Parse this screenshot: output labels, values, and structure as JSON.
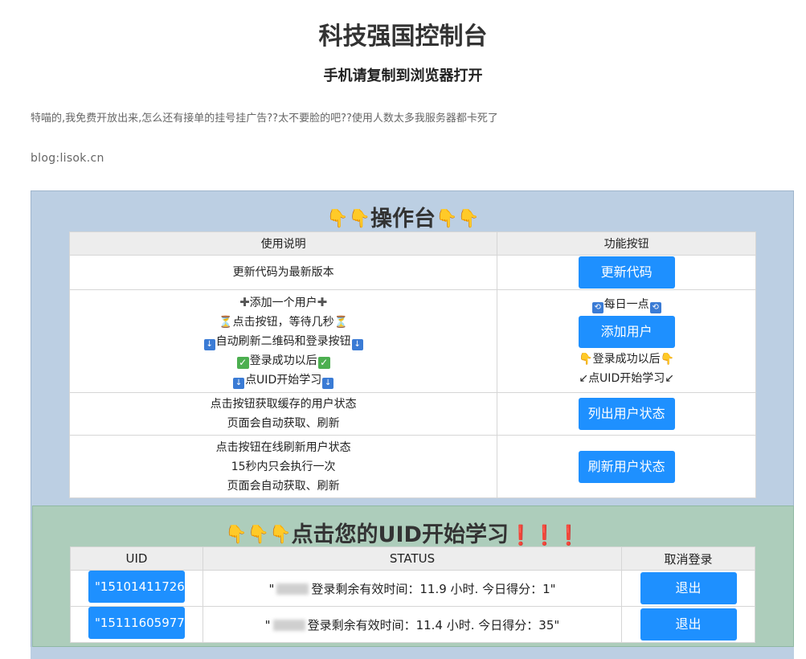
{
  "header": {
    "title": "科技强国控制台",
    "subtitle": "手机请复制到浏览器打开",
    "notice": "特喵的,我免费开放出来,怎么还有接单的挂号挂广告??太不要脸的吧??使用人数太多我服务器都卡死了",
    "blog": "blog:lisok.cn"
  },
  "ops_panel": {
    "title": "操作台",
    "columns": [
      "使用说明",
      "功能按钮"
    ],
    "rows": [
      {
        "desc": [
          "更新代码为最新版本"
        ],
        "button": "更新代码"
      },
      {
        "desc": [
          "添加一个用户",
          "点击按钮，等待几秒",
          "自动刷新二维码和登录按钮",
          "登录成功以后",
          "点UID开始学习"
        ],
        "above": "每日一点",
        "button": "添加用户",
        "below": [
          "登录成功以后",
          "点UID开始学习"
        ]
      },
      {
        "desc": [
          "点击按钮获取缓存的用户状态",
          "页面会自动获取、刷新"
        ],
        "button": "列出用户状态"
      },
      {
        "desc": [
          "点击按钮在线刷新用户状态",
          "15秒内只会执行一次",
          "页面会自动获取、刷新"
        ],
        "button": "刷新用户状态"
      }
    ]
  },
  "users_panel": {
    "title": "点击您的UID开始学习",
    "columns": [
      "UID",
      "STATUS",
      "取消登录"
    ],
    "rows": [
      {
        "uid": "\"15101411726\"",
        "status_prefix": "\"",
        "status": "登录剩余有效时间：11.9 小时. 今日得分：1\"",
        "action": "退出"
      },
      {
        "uid": "\"15111605977\"",
        "status_prefix": "\"",
        "status": "登录剩余有效时间：11.4 小时. 今日得分：35\"",
        "action": "退出"
      }
    ]
  },
  "colors": {
    "accent": "#1e90ff",
    "panel_blue": "#bccfe3",
    "panel_green": "#adcdbb"
  },
  "icons": [
    "pointing-hand-icon",
    "plus-icon",
    "hourglass-icon",
    "down-arrow-icon",
    "check-icon",
    "repeat-icon",
    "exclamation-icon"
  ]
}
